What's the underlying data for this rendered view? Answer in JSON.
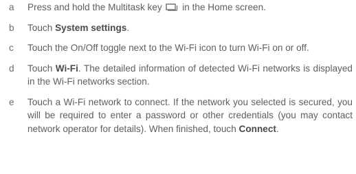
{
  "steps": [
    {
      "letter": "a",
      "parts": {
        "before": "Press and hold the Multitask key ",
        "icon": "multitask-key-icon",
        "after": " in the Home screen."
      }
    },
    {
      "letter": "b",
      "parts": {
        "before": "Touch ",
        "bold": "System settings",
        "after": "."
      }
    },
    {
      "letter": "c",
      "parts": {
        "before": "Touch the On/Off toggle next to the Wi-Fi icon to turn Wi-Fi on or off."
      }
    },
    {
      "letter": "d",
      "parts": {
        "before": "Touch ",
        "bold": "Wi-Fi",
        "after": ". The detailed information of detected Wi-Fi networks is displayed in the Wi-Fi networks section."
      }
    },
    {
      "letter": "e",
      "parts": {
        "before": "Touch a Wi-Fi network to connect. If the network you selected is secured, you will be required to enter a password or other credentials (you may contact network operator for details). When finished, touch ",
        "bold": "Connect",
        "after": "."
      }
    }
  ]
}
